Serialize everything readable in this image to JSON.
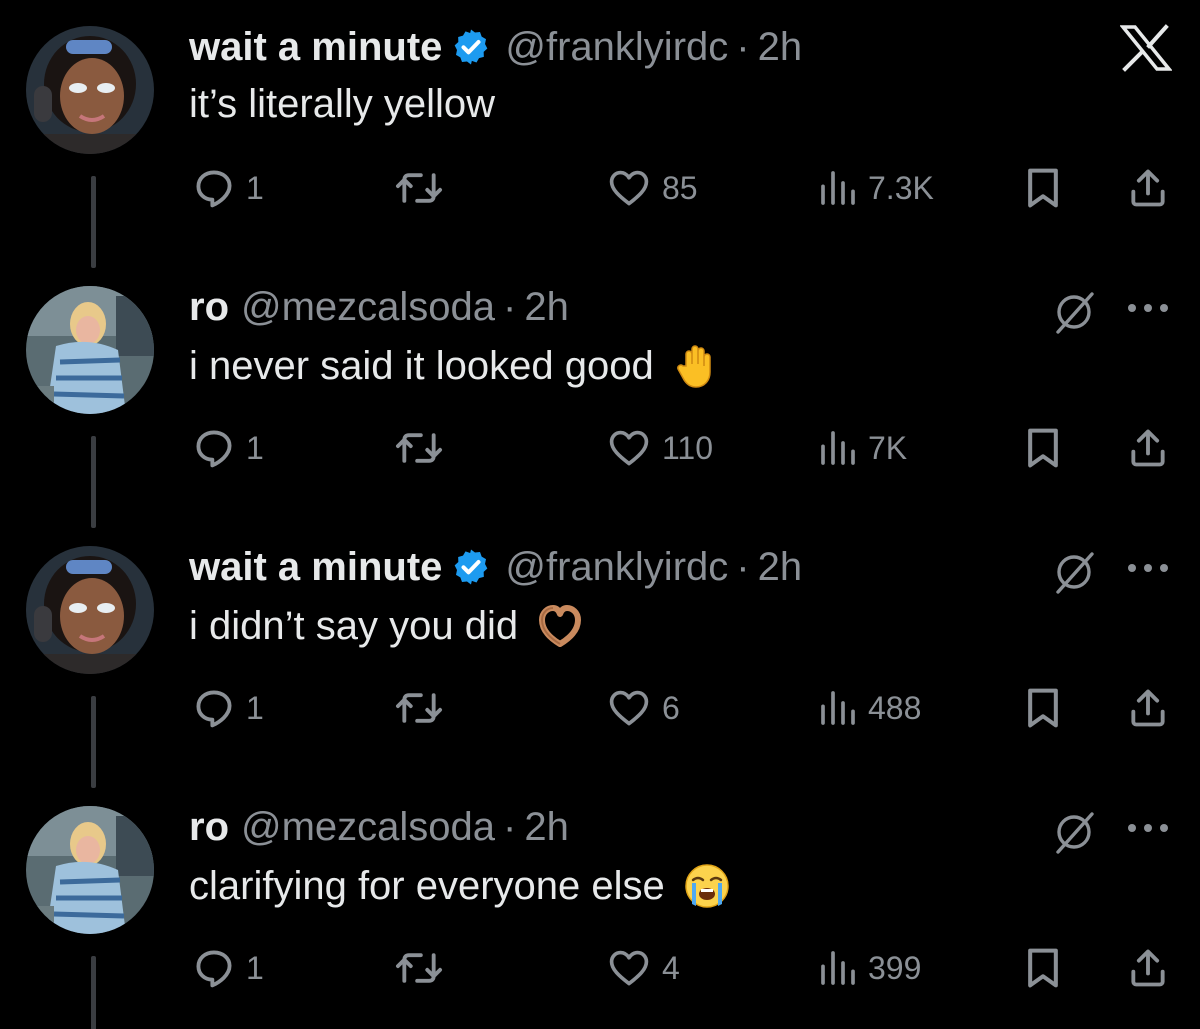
{
  "colors": {
    "background": "#000000",
    "text_primary": "#e7e9ea",
    "text_secondary": "#8b9096",
    "verified_blue": "#1d9bf0",
    "thread_line": "#3a3d41"
  },
  "app": {
    "logo_icon": "x-logo-icon"
  },
  "tweets": [
    {
      "display_name": "wait a minute",
      "verified": true,
      "handle": "@franklyirdc",
      "separator": "·",
      "time": "2h",
      "text": "it’s literally yellow",
      "emoji": "",
      "corner": "x-logo",
      "counts": {
        "replies": "1",
        "likes": "85",
        "views": "7.3K"
      }
    },
    {
      "display_name": "ro",
      "verified": false,
      "handle": "@mezcalsoda",
      "separator": "·",
      "time": "2h",
      "text": "i never said it looked good",
      "emoji": "raised-hand-emoji",
      "corner": "grok-and-more",
      "counts": {
        "replies": "1",
        "likes": "110",
        "views": "7K"
      }
    },
    {
      "display_name": "wait a minute",
      "verified": true,
      "handle": "@franklyirdc",
      "separator": "·",
      "time": "2h",
      "text": "i didn’t say you did",
      "emoji": "heart-hands-emoji",
      "corner": "grok-and-more",
      "counts": {
        "replies": "1",
        "likes": "6",
        "views": "488"
      }
    },
    {
      "display_name": "ro",
      "verified": false,
      "handle": "@mezcalsoda",
      "separator": "·",
      "time": "2h",
      "text": "clarifying for everyone else",
      "emoji": "loudly-crying-face-emoji",
      "corner": "grok-and-more",
      "counts": {
        "replies": "1",
        "likes": "4",
        "views": "399"
      }
    }
  ]
}
